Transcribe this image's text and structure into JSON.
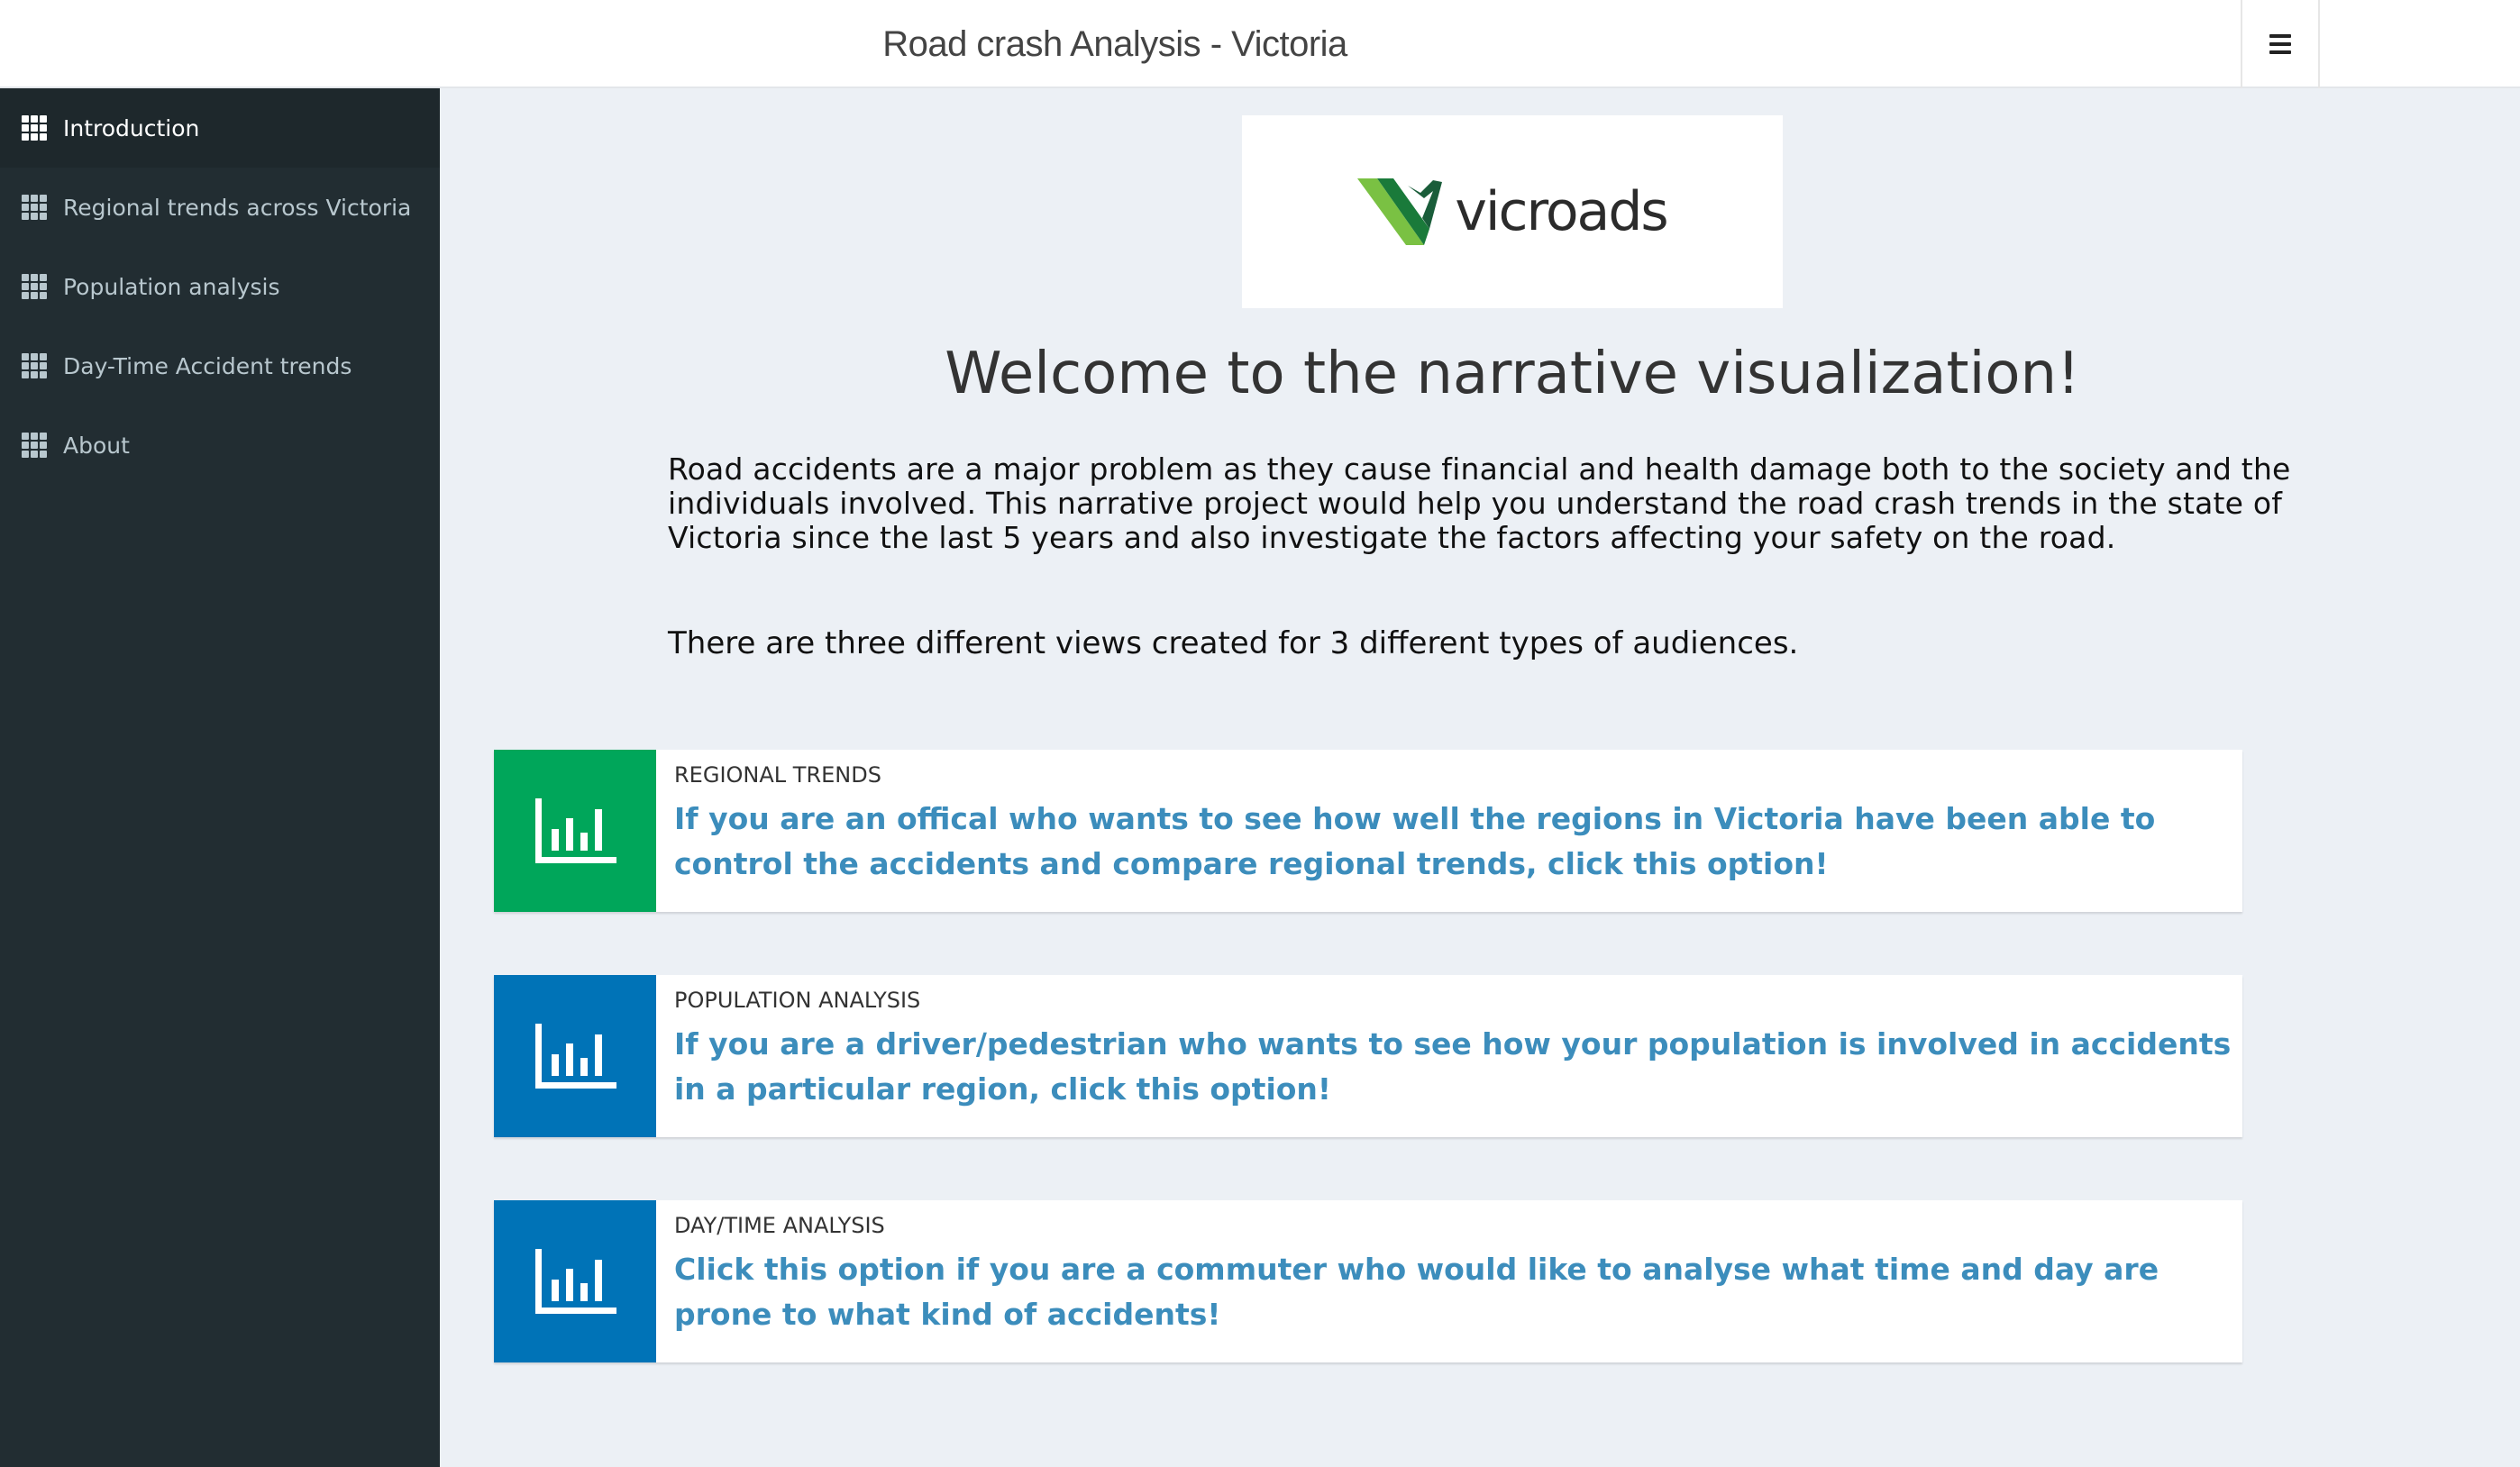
{
  "header": {
    "title": "Road crash Analysis - Victoria",
    "menu_icon": "hamburger-icon"
  },
  "sidebar": {
    "items": [
      {
        "label": "Introduction",
        "icon": "grid-icon",
        "active": true
      },
      {
        "label": "Regional trends across Victoria",
        "icon": "grid-icon",
        "active": false
      },
      {
        "label": "Population analysis",
        "icon": "grid-icon",
        "active": false
      },
      {
        "label": "Day-Time Accident trends",
        "icon": "grid-icon",
        "active": false
      },
      {
        "label": "About",
        "icon": "grid-icon",
        "active": false
      }
    ]
  },
  "main": {
    "logo": {
      "text": "vicroads"
    },
    "welcome": "Welcome to the narrative visualization!",
    "intro": "Road accidents are a major problem as they cause financial and health damage both to the society and the individuals involved. This narrative project would help you understand the road crash trends in the state of Victoria since the last 5 years and also investigate the factors affecting your safety on the road.",
    "views_text": "There are three different views created for 3 different types of audiences.",
    "info_boxes": [
      {
        "label": "REGIONAL TRENDS",
        "text": "If you are an offical who wants to see how well the regions in Victoria have been able to control the accidents and compare regional trends, click this option!",
        "icon": "bar-chart-icon",
        "color": "#00a65a"
      },
      {
        "label": "POPULATION ANALYSIS",
        "text": "If you are a driver/pedestrian who wants to see how your population is involved in accidents in a particular region, click this option!",
        "icon": "bar-chart-icon",
        "color": "#0073b7"
      },
      {
        "label": "DAY/TIME ANALYSIS",
        "text": "Click this option if you are a commuter who would like to analyse what time and day are prone to what kind of accidents!",
        "icon": "bar-chart-icon",
        "color": "#0073b7"
      }
    ]
  },
  "colors": {
    "sidebar_bg": "#222d32",
    "sidebar_active_bg": "#1e282c",
    "content_bg": "#ecf0f5",
    "link_blue": "#3c8dbc",
    "logo_green_dark": "#1a7a3a",
    "logo_green_light": "#7ac143"
  }
}
